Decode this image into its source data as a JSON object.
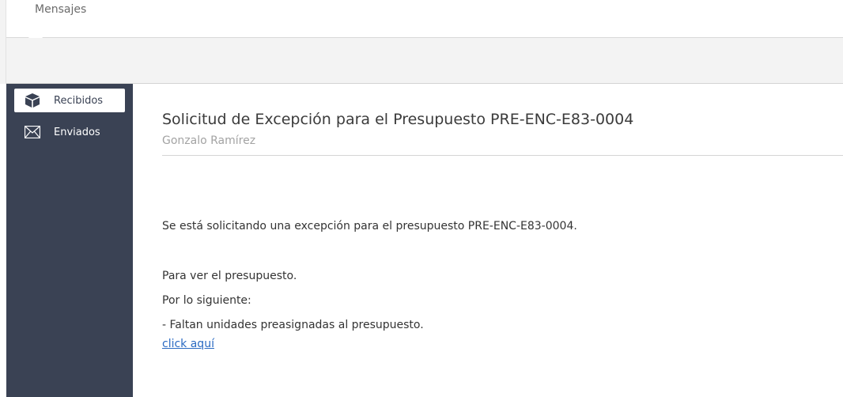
{
  "header": {
    "tab_label": "Mensajes"
  },
  "sidebar": {
    "items": [
      {
        "label": "Recibidos",
        "icon": "box-icon",
        "active": true
      },
      {
        "label": "Enviados",
        "icon": "envelope-icon",
        "active": false
      }
    ]
  },
  "message": {
    "subject": "Solicitud de Excepción para el Presupuesto PRE-ENC-E83-0004",
    "sender": "Gonzalo Ramírez",
    "body": [
      "Se está solicitando una excepción para el presupuesto PRE-ENC-E83-0004.",
      "Para ver el presupuesto.",
      "Por lo siguiente:",
      "- Faltan unidades preasignadas al presupuesto."
    ],
    "link_text": "click aquí"
  },
  "colors": {
    "sidebar_bg": "#3a4254",
    "link": "#2a6ac2",
    "band_bg": "#f3f3f3"
  }
}
